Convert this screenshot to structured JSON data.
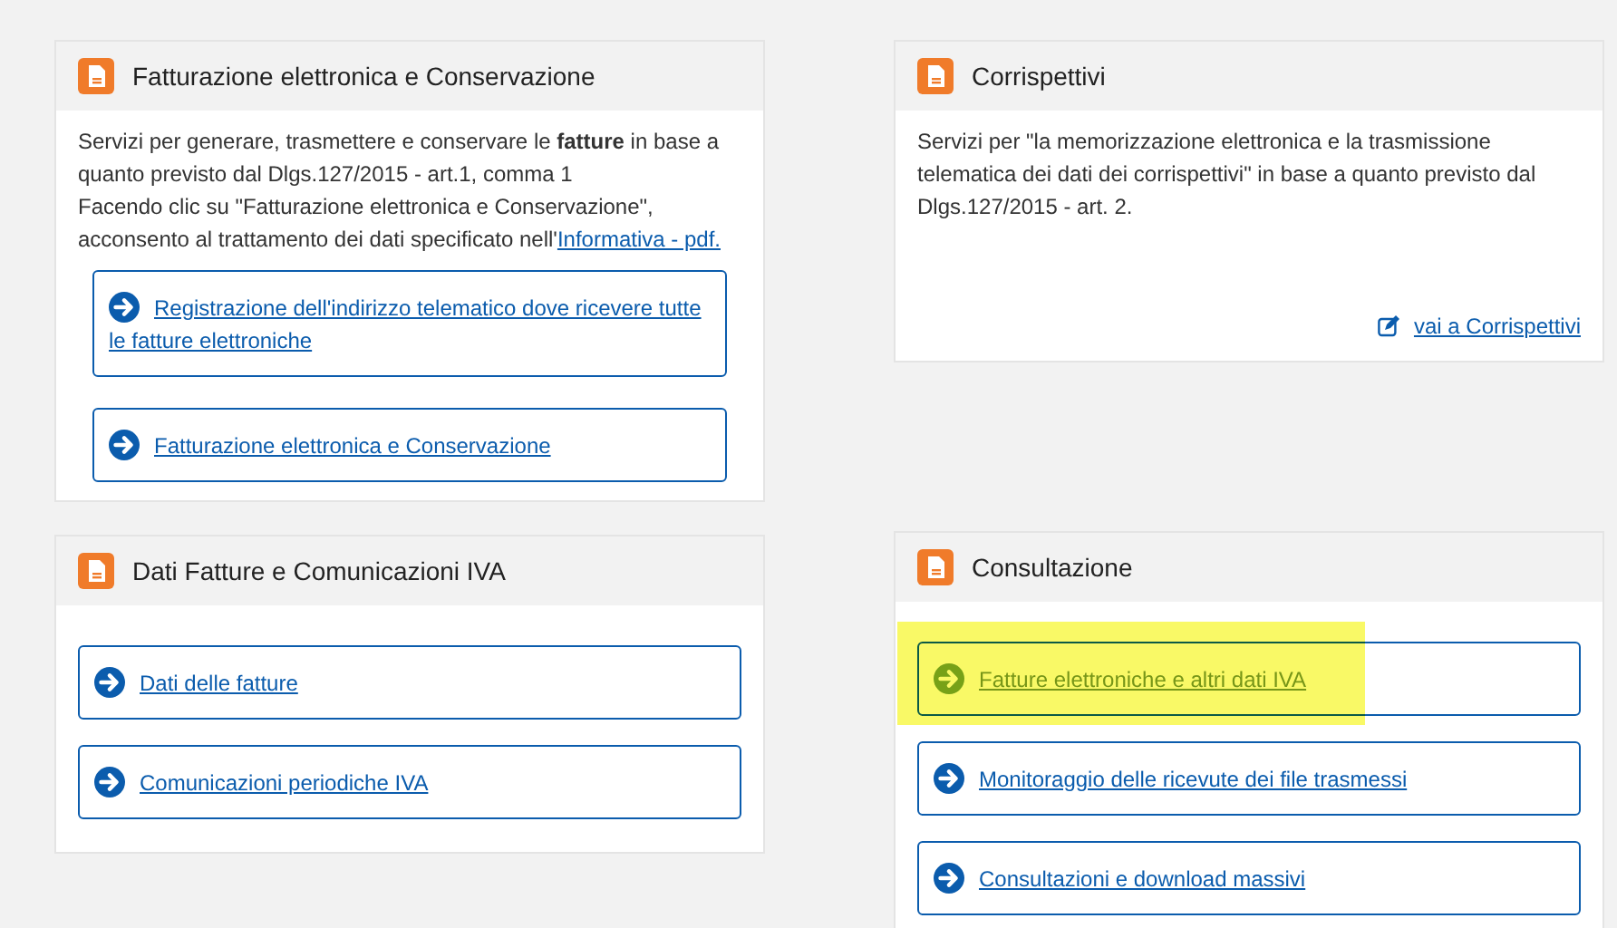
{
  "cards": [
    {
      "title": "Fatturazione elettronica e Conservazione",
      "description": "Servizi per generare, trasmettere e conservare le **fatture** in base a quanto previsto dal Dlgs.127/2015 - art.1, comma 1",
      "consent_text": "Facendo clic su \"Fatturazione elettronica e Conservazione\", acconsento al trattamento dei dati specificato nell'",
      "consent_link": "Informativa - pdf.",
      "links": [
        {
          "label": "Registrazione dell'indirizzo telematico dove ricevere tutte le fatture elettroniche",
          "highlighted": false
        },
        {
          "label": "Fatturazione elettronica e Conservazione",
          "highlighted": false
        }
      ]
    },
    {
      "title": "Corrispettivi",
      "description": "Servizi per \"la memorizzazione elettronica e la trasmissione telematica dei dati dei corrispettivi\" in base a quanto previsto dal Dlgs.127/2015 - art. 2.",
      "footer_link": "vai a Corrispettivi"
    },
    {
      "title": "Dati Fatture e Comunicazioni IVA",
      "links": [
        {
          "label": "Dati delle fatture",
          "highlighted": false
        },
        {
          "label": "Comunicazioni periodiche IVA",
          "highlighted": false
        }
      ]
    },
    {
      "title": "Consultazione",
      "links": [
        {
          "label": "Fatture elettroniche e altri dati IVA",
          "highlighted": true
        },
        {
          "label": "Monitoraggio delle ricevute dei file trasmessi",
          "highlighted": false
        },
        {
          "label": "Consultazioni e download massivi",
          "highlighted": false
        }
      ]
    }
  ]
}
